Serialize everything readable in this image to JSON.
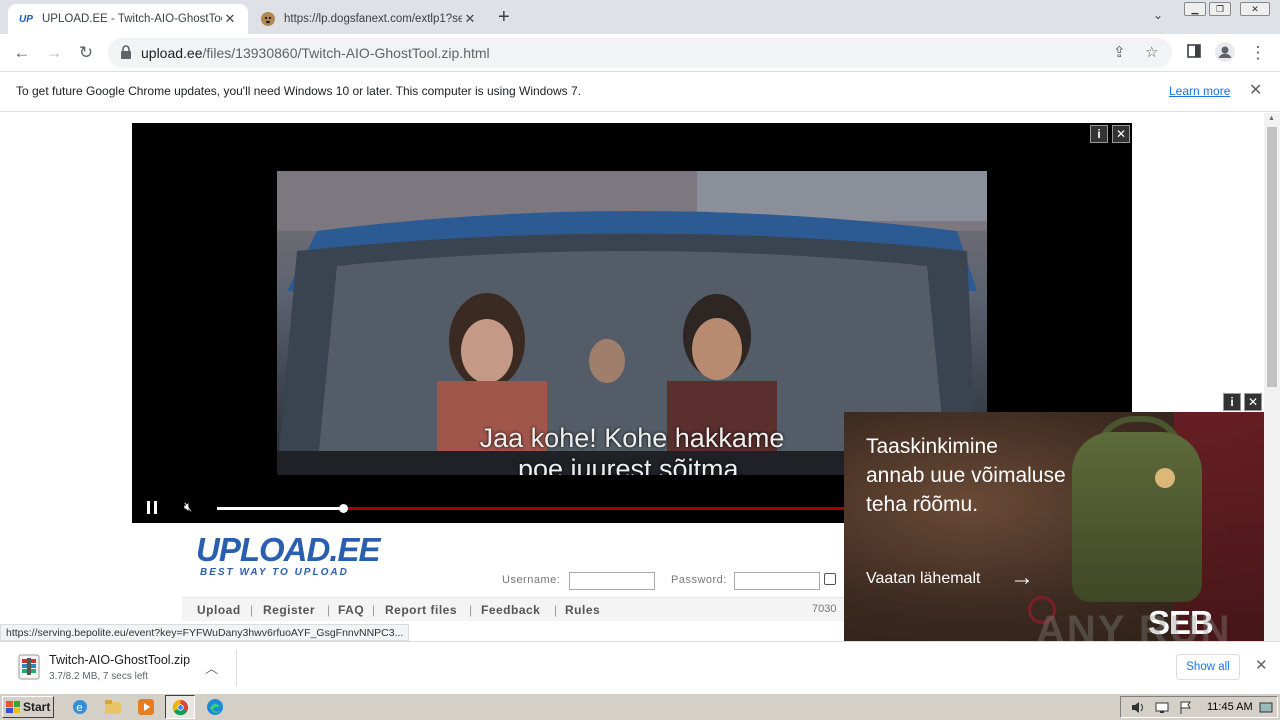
{
  "browser": {
    "tabs": [
      {
        "favicon": "UP",
        "title": "UPLOAD.EE - Twitch-AIO-GhostTool.z",
        "active": true
      },
      {
        "favicon": "dog-icon",
        "title": "https://lp.dogsfanext.com/extlp1?se",
        "active": false
      }
    ],
    "new_tab_label": "+",
    "url_host": "upload.ee",
    "url_path": "/files/13930860/Twitch-AIO-GhostTool.zip.html"
  },
  "infobar": {
    "message": "To get future Google Chrome updates, you'll need Windows 10 or later. This computer is using Windows 7.",
    "link": "Learn more"
  },
  "video_ad": {
    "subtitle_line1": "Jaa kohe! Kohe hakkame",
    "subtitle_line2": "poe juurest sõitma.",
    "progress": 0.2,
    "info_label": "i",
    "close_label": "✕"
  },
  "site": {
    "logo": "UPLOAD.EE",
    "tagline": "BEST WAY TO UPLOAD",
    "username_label": "Username:",
    "password_label": "Password:",
    "menu": [
      "Upload",
      "Register",
      "FAQ",
      "Report files",
      "Feedback",
      "Rules"
    ],
    "counter": "7030"
  },
  "status_url": "https://serving.bepolite.eu/event?key=FYFWuDany3hwv6rfuoAYF_GsgFnnvNNPC3...",
  "seb_ad": {
    "headline_1": "Taaskinkimine",
    "headline_2": "annab uue võimaluse",
    "headline_3": "teha rõõmu.",
    "cta": "Vaatan lähemalt",
    "brand": "SEB",
    "info_label": "i",
    "close_label": "✕"
  },
  "watermark": "ANY RUN",
  "download": {
    "filename": "Twitch-AIO-GhostTool.zip",
    "status": "3.7/8.2 MB, 7 secs left",
    "show_all": "Show all"
  },
  "taskbar": {
    "start_label": "Start",
    "clock": "11:45 AM"
  }
}
